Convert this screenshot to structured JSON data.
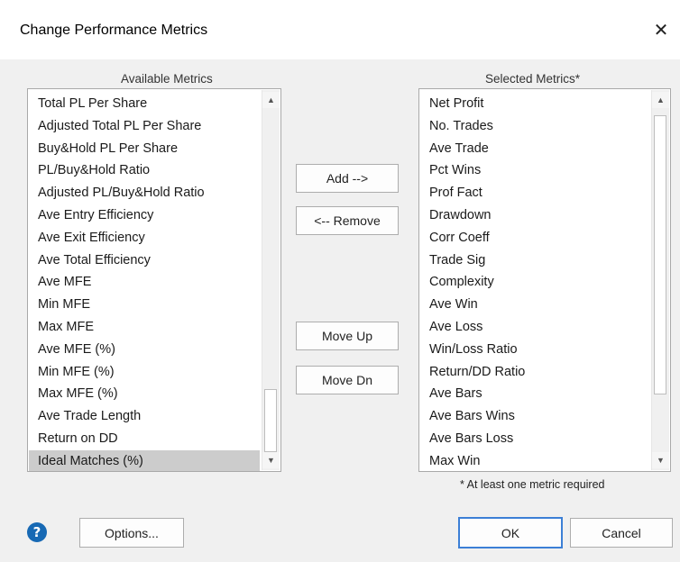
{
  "window": {
    "title": "Change Performance Metrics",
    "close_glyph": "✕"
  },
  "available": {
    "label": "Available Metrics",
    "items": [
      "Total PL Per Share",
      "Adjusted Total PL Per Share",
      "Buy&Hold PL Per Share",
      "PL/Buy&Hold Ratio",
      "Adjusted PL/Buy&Hold Ratio",
      "Ave Entry Efficiency",
      "Ave Exit Efficiency",
      "Ave Total Efficiency",
      "Ave MFE",
      "Min MFE",
      "Max MFE",
      "Ave MFE (%)",
      "Min MFE (%)",
      "Max MFE (%)",
      "Ave Trade Length",
      "Return on DD",
      "Ideal Matches (%)"
    ],
    "selected_item": "Ideal Matches (%)"
  },
  "selected": {
    "label": "Selected Metrics*",
    "items": [
      "Net Profit",
      "No. Trades",
      "Ave Trade",
      "Pct Wins",
      "Prof Fact",
      "Drawdown",
      "Corr Coeff",
      "Trade Sig",
      "Complexity",
      "Ave Win",
      "Ave Loss",
      "Win/Loss Ratio",
      "Return/DD Ratio",
      "Ave Bars",
      "Ave Bars Wins",
      "Ave Bars Loss",
      "Max Win"
    ],
    "note": "* At least one metric required"
  },
  "buttons": {
    "add": "Add -->",
    "remove": "<-- Remove",
    "move_up": "Move Up",
    "move_dn": "Move Dn",
    "options": "Options...",
    "ok": "OK",
    "cancel": "Cancel",
    "help_glyph": "?"
  },
  "icons": {
    "scroll_up": "▲",
    "scroll_down": "▼"
  },
  "colors": {
    "accent": "#1769b4",
    "selection": "#cccccc",
    "default_border": "#3c7fd6"
  }
}
